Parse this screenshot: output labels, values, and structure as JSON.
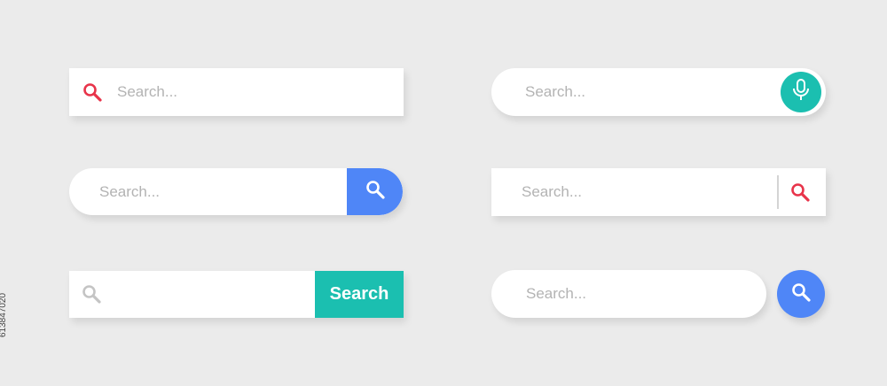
{
  "colors": {
    "background": "#ebebeb",
    "red": "#e8344a",
    "blue": "#4f86f7",
    "teal": "#1bbfb0",
    "placeholder": "#b3b3b3"
  },
  "search_bars": [
    {
      "placeholder": "Search...",
      "icon": "search-icon"
    },
    {
      "placeholder": "Search...",
      "icon": "mic-icon"
    },
    {
      "placeholder": "Search...",
      "icon": "search-icon"
    },
    {
      "placeholder": "Search...",
      "icon": "search-icon"
    },
    {
      "placeholder": "",
      "button_label": "Search",
      "icon": "search-icon"
    },
    {
      "placeholder": "Search...",
      "icon": "search-icon"
    }
  ],
  "stock_id": "613847020"
}
